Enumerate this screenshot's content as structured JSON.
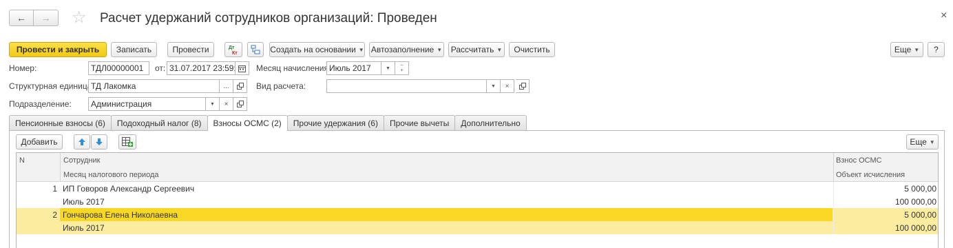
{
  "window": {
    "title": "Расчет удержаний сотрудников организаций: Проведен",
    "close_glyph": "×"
  },
  "toolbar": {
    "post_close": "Провести и закрыть",
    "save": "Записать",
    "post": "Провести",
    "create_based": "Создать на основании",
    "autofill": "Автозаполнение",
    "calculate": "Рассчитать",
    "clear": "Очистить",
    "more": "Еще",
    "help": "?"
  },
  "form": {
    "number_label": "Номер:",
    "number_value": "ТДЛ00000001",
    "from_label": "от:",
    "date_value": "31.07.2017 23:59:59",
    "month_label": "Месяц начисления:",
    "month_value": "Июль 2017",
    "unit_label": "Структурная единица:",
    "unit_value": "ТД Лакомка",
    "calc_type_label": "Вид расчета:",
    "calc_type_value": "",
    "dept_label": "Подразделение:",
    "dept_value": "Администрация"
  },
  "tabs": [
    {
      "label": "Пенсионные взносы (6)"
    },
    {
      "label": "Подоходный налог (8)"
    },
    {
      "label": "Взносы ОСМС (2)",
      "active": true
    },
    {
      "label": "Прочие удержания (6)"
    },
    {
      "label": "Прочие вычеты"
    },
    {
      "label": "Дополнительно"
    }
  ],
  "table_toolbar": {
    "add": "Добавить",
    "more": "Еще"
  },
  "table": {
    "columns": {
      "n": "N",
      "employee": "Сотрудник",
      "tax_month": "Месяц налогового периода",
      "contribution": "Взнос ОСМС",
      "base": "Объект исчисления"
    },
    "rows": [
      {
        "n": "1",
        "employee": "ИП Говоров Александр Сергеевич",
        "month": "Июль 2017",
        "contribution": "5 000,00",
        "base": "100 000,00"
      },
      {
        "n": "2",
        "employee": "Гончарова Елена Николаевна",
        "month": "Июль 2017",
        "contribution": "5 000,00",
        "base": "100 000,00"
      }
    ]
  },
  "colors": {
    "primary_button": "#f3c914",
    "selected_row": "#fbec9f",
    "selected_cell": "#f9d825"
  }
}
